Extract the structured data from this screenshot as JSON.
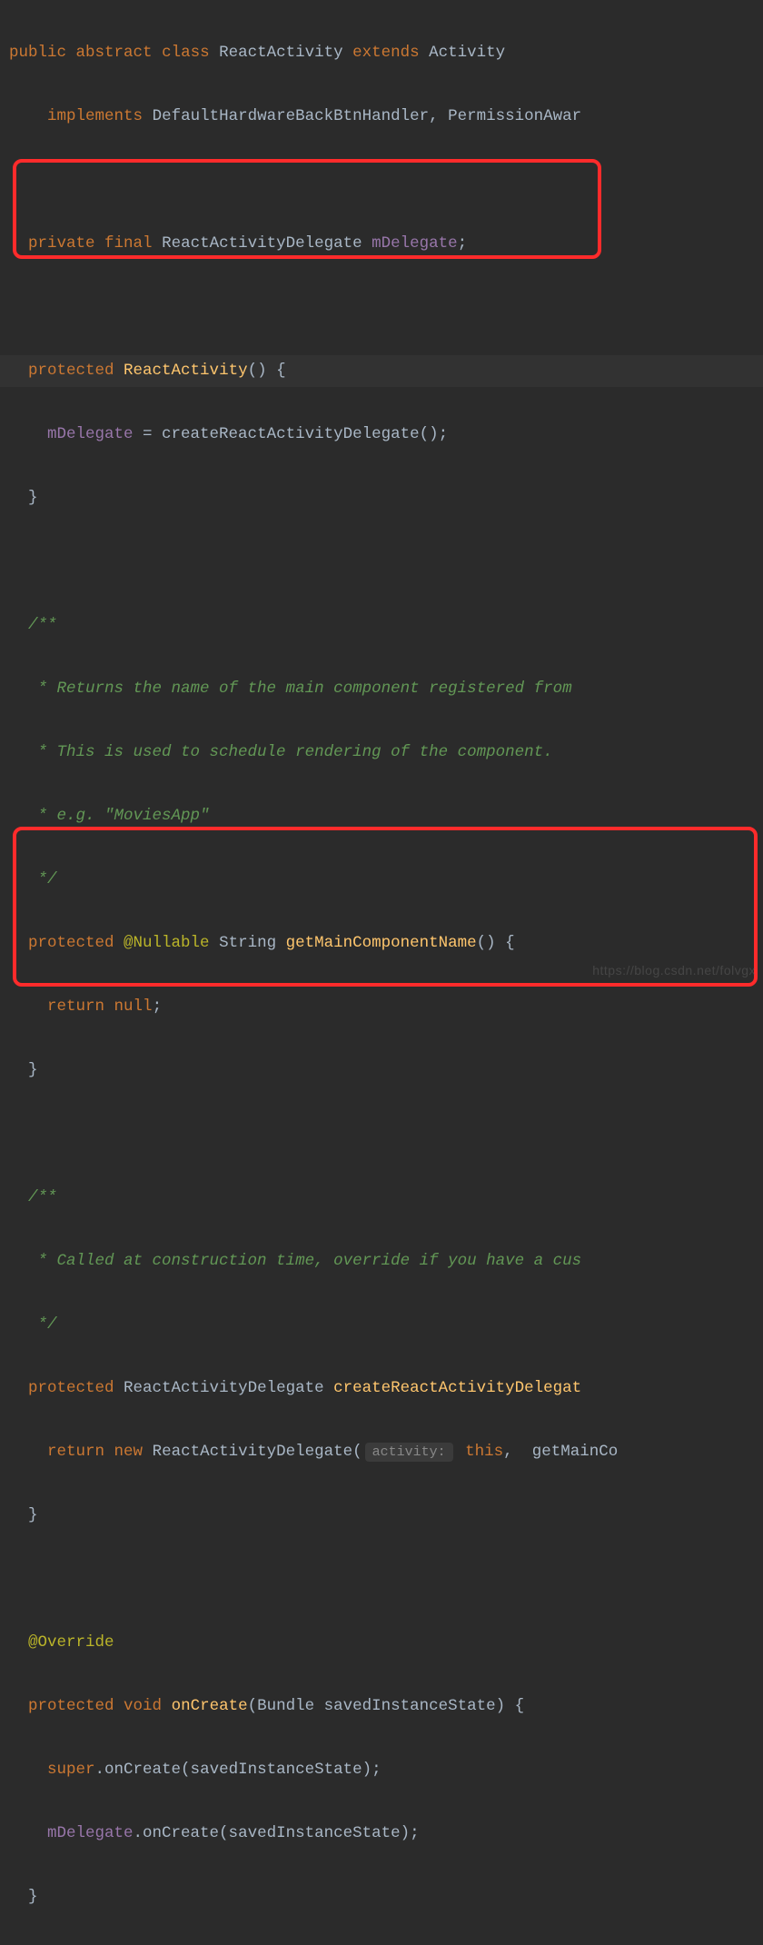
{
  "code": {
    "l1": {
      "public": "public",
      "abstract": "abstract",
      "class": "class",
      "name": "ReactActivity",
      "extends": "extends",
      "parent": "Activity"
    },
    "l2": {
      "implements": "implements",
      "iface1": "DefaultHardwareBackBtnHandler",
      "comma": ",",
      "iface2": "PermissionAwar"
    },
    "l3": {
      "private": "private",
      "final": "final",
      "type": "ReactActivityDelegate",
      "field": "mDelegate",
      "semi": ";"
    },
    "l4": {
      "protected": "protected",
      "name": "ReactActivity",
      "parens": "() {"
    },
    "l5": {
      "field": "mDelegate",
      "eq": " = ",
      "call": "createReactActivityDelegate();"
    },
    "l6": {
      "brace": "}"
    },
    "c1a": "/**",
    "c1b": " * Returns the name of the main component registered from ",
    "c1c": " * This is used to schedule rendering of the component.",
    "c1d": " * e.g. \"MoviesApp\"",
    "c1e": " */",
    "l7": {
      "protected": "protected",
      "ann": "@Nullable",
      "type": "String",
      "name": "getMainComponentName",
      "parens": "() {"
    },
    "l8": {
      "return": "return",
      "null": "null",
      "semi": ";"
    },
    "l9": {
      "brace": "}"
    },
    "c2a": "/**",
    "c2b": " * Called at construction time, override if you have a cus",
    "c2c": " */",
    "l10": {
      "protected": "protected",
      "type": "ReactActivityDelegate",
      "name": "createReactActivityDelegat"
    },
    "l11": {
      "return": "return",
      "new": "new",
      "type": "ReactActivityDelegate(",
      "hint": "activity:",
      "this": "this",
      "comma": ",",
      "rest": "getMainCo"
    },
    "l12": {
      "brace": "}"
    },
    "l13": {
      "ann": "@Override"
    },
    "l14": {
      "protected": "protected",
      "void": "void",
      "name": "onCreate",
      "paren1": "(",
      "ptype": "Bundle",
      "pname": "savedInstanceState",
      "paren2": ") {"
    },
    "l15": {
      "super": "super",
      "dot": ".",
      "call": "onCreate(savedInstanceState);"
    },
    "l16": {
      "field": "mDelegate",
      "dot": ".",
      "call": "onCreate(savedInstanceState);"
    },
    "l17": {
      "brace": "}"
    }
  },
  "watermark": "https://blog.csdn.net/folvgx"
}
